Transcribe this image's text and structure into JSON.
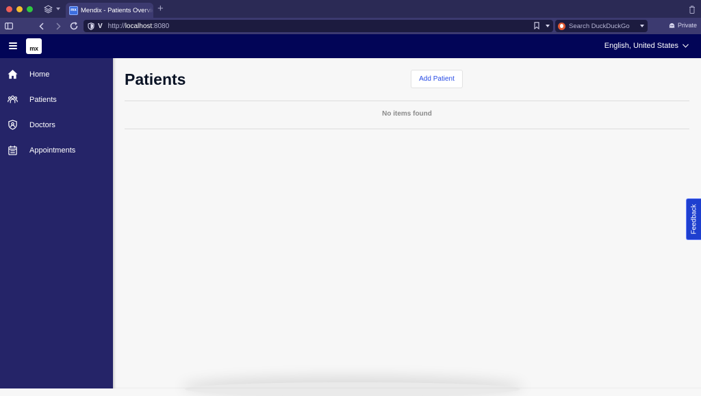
{
  "browser": {
    "tab": {
      "favicon_text": "mx",
      "title": "Mendix - Patients Overview"
    },
    "new_tab_label": "+",
    "url": {
      "scheme": "http://",
      "host": "localhost",
      "port": ":8080"
    },
    "search_placeholder": "Search DuckDuckGo",
    "private_label": "Private"
  },
  "header": {
    "logo_text": "mx",
    "language": "English, United States"
  },
  "sidebar": {
    "items": [
      {
        "label": "Home",
        "icon": "home-icon"
      },
      {
        "label": "Patients",
        "icon": "users-icon"
      },
      {
        "label": "Doctors",
        "icon": "doctor-badge-icon"
      },
      {
        "label": "Appointments",
        "icon": "calendar-icon"
      }
    ]
  },
  "main": {
    "title": "Patients",
    "add_button_label": "Add Patient",
    "empty_message": "No items found"
  },
  "feedback_label": "Feedback",
  "colors": {
    "header_bg": "#020557",
    "sidebar_bg": "#252468",
    "accent": "#264ae5",
    "feedback_bg": "#1e3fcf"
  }
}
